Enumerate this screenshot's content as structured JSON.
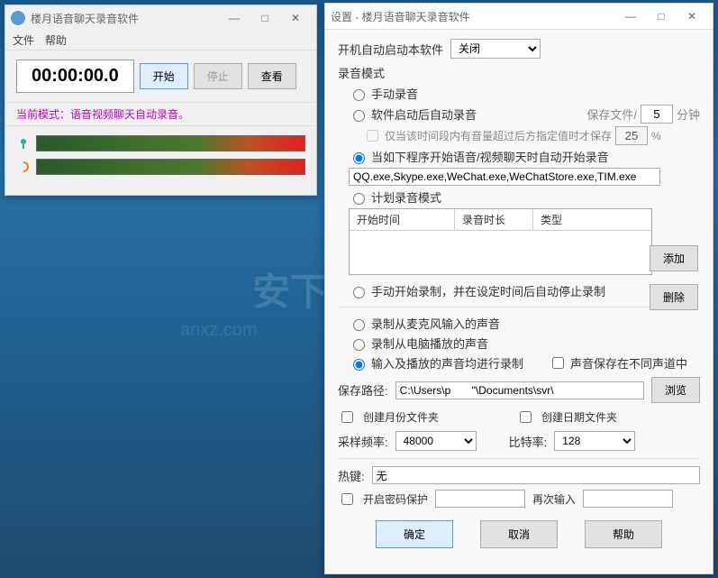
{
  "win1": {
    "title": "楼月语音聊天录音软件",
    "menu": {
      "file": "文件",
      "help": "帮助"
    },
    "timer": "00:00:00.0",
    "btn_start": "开始",
    "btn_stop": "停止",
    "btn_view": "查看",
    "mode": "当前模式：语音视频聊天自动录音。"
  },
  "win2": {
    "title": "设置 - 楼月语音聊天录音软件",
    "autostart_label": "开机自动启动本软件",
    "autostart_value": "关闭",
    "rec_mode_title": "录音模式",
    "manual": "手动录音",
    "auto_after_start": "软件启动后自动录音",
    "save_file": "保存文件/",
    "save_minutes": "5",
    "minutes": "分钟",
    "only_when": "仅当该时间段内有音量超过后方指定值时才保存",
    "only_when_pct": "25",
    "pct": "%",
    "proc_opt": "当如下程序开始语音/视频聊天时自动开始录音",
    "proc_list": "QQ.exe,Skype.exe,WeChat.exe,WeChatStore.exe,TIM.exe",
    "sched": "计划录音模式",
    "col_start": "开始时间",
    "col_dur": "录音时长",
    "col_type": "类型",
    "add": "添加",
    "del": "删除",
    "auto_stop": "手动开始录制，并在设定时间后自动停止录制",
    "source_mic": "录制从麦克风输入的声音",
    "source_pc": "录制从电脑播放的声音",
    "source_both": "输入及播放的声音均进行录制",
    "sep_channel": "声音保存在不同声道中",
    "save_path_label": "保存路径:",
    "save_path": "C:\\Users\\p       \"\\Documents\\svr\\",
    "browse": "浏览",
    "folder_month": "创建月份文件夹",
    "folder_date": "创建日期文件夹",
    "sample_rate_label": "采样频率:",
    "sample_rate": "48000",
    "bitrate_label": "比特率:",
    "bitrate": "128",
    "hotkey_label": "热键:",
    "hotkey": "无",
    "password": "开启密码保护",
    "again": "再次输入",
    "ok": "确定",
    "cancel": "取消",
    "help": "帮助"
  }
}
